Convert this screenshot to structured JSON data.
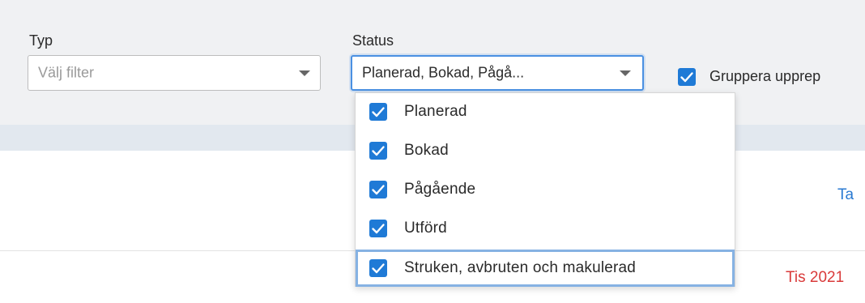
{
  "filters": {
    "typ": {
      "label": "Typ",
      "placeholder": "Välj filter"
    },
    "status": {
      "label": "Status",
      "value": "Planerad, Bokad, Pågå..."
    },
    "group_checkbox": {
      "label": "Gruppera upprep",
      "checked": true
    }
  },
  "status_dropdown": {
    "options": [
      {
        "label": "Planerad",
        "checked": true
      },
      {
        "label": "Bokad",
        "checked": true
      },
      {
        "label": "Pågående",
        "checked": true
      },
      {
        "label": "Utförd",
        "checked": true
      },
      {
        "label": "Struken, avbruten och makulerad",
        "checked": true,
        "highlighted": true
      }
    ]
  },
  "content": {
    "link_text": "Ta",
    "date_text": "Tis 2021"
  },
  "colors": {
    "accent": "#1f7ad6",
    "focus_border": "#4a90e2",
    "link": "#2a7ad2",
    "date_red": "#d93a3a"
  }
}
